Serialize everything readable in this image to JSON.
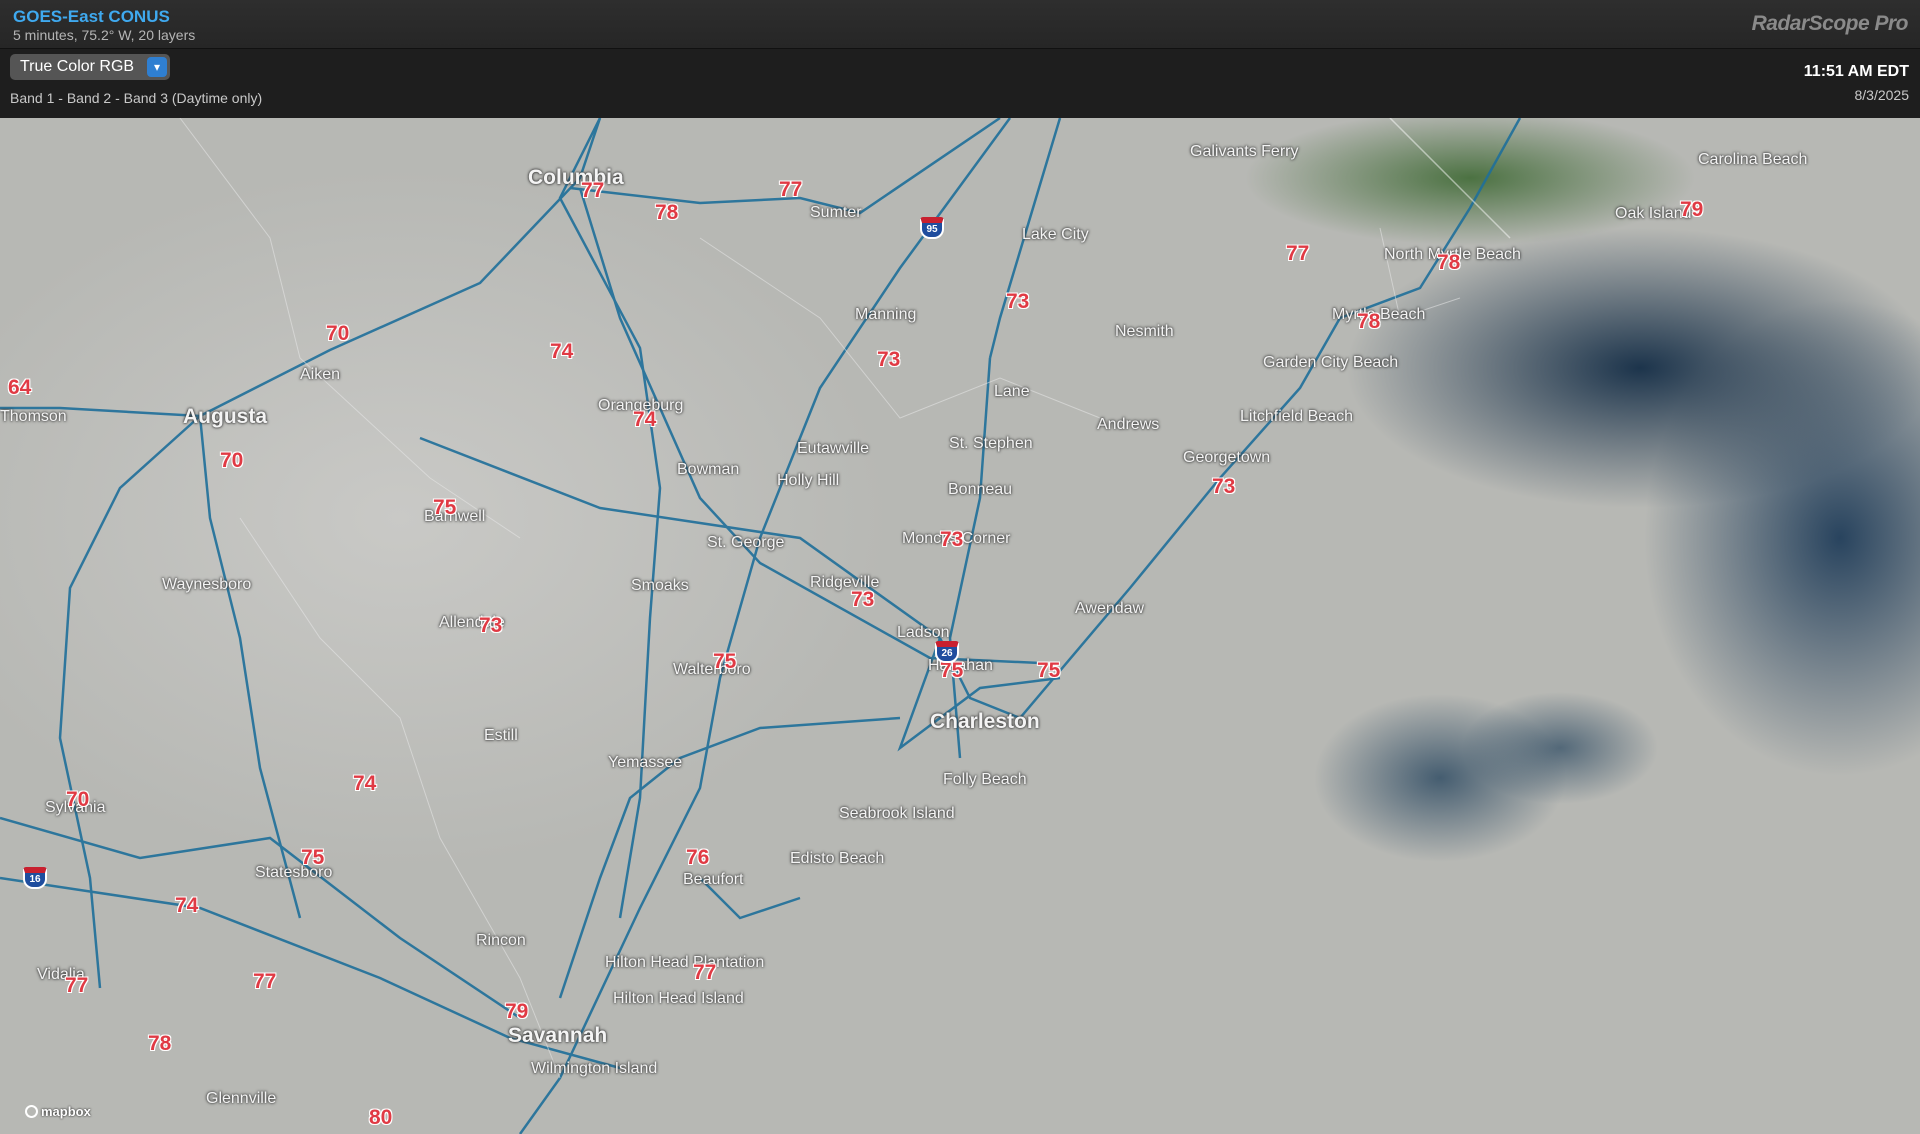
{
  "header": {
    "title": "GOES-East CONUS",
    "subtitle": "5 minutes, 75.2° W, 20 layers",
    "brand": "RadarScope Pro"
  },
  "controls": {
    "product": "True Color RGB",
    "band_description": "Band 1 - Band 2 - Band 3 (Daytime only)",
    "time": "11:51 AM EDT",
    "date": "8/3/2025"
  },
  "map": {
    "attribution": "mapbox",
    "places": [
      "Columbia",
      "Sumter",
      "Lake City",
      "Galivants Ferry",
      "Carolina Beach",
      "Oak Island",
      "North Myrtle Beach",
      "Myrtle Beach",
      "Manning",
      "Nesmith",
      "Garden City Beach",
      "Aiken",
      "Augusta",
      "Thomson",
      "Orangeburg",
      "Lane",
      "Andrews",
      "Litchfield Beach",
      "Eutawville",
      "St. Stephen",
      "Georgetown",
      "Bowman",
      "Holly Hill",
      "Bonneau",
      "Barnwell",
      "St. George",
      "Moncks Corner",
      "Waynesboro",
      "Smoaks",
      "Ridgeville",
      "Awendaw",
      "Allendale",
      "Ladson",
      "Hanahan",
      "Walterboro",
      "Charleston",
      "Estill",
      "Yemassee",
      "Folly Beach",
      "Sylvania",
      "Seabrook Island",
      "Statesboro",
      "Beaufort",
      "Edisto Beach",
      "Rincon",
      "Vidalia",
      "Hilton Head Plantation",
      "Hilton Head Island",
      "Savannah",
      "Wilmington Island",
      "Glennville"
    ],
    "temperatures": [
      "77",
      "78",
      "77",
      "77",
      "79",
      "78",
      "78",
      "73",
      "73",
      "70",
      "74",
      "64",
      "74",
      "70",
      "75",
      "73",
      "73",
      "73",
      "73",
      "75",
      "75",
      "75",
      "70",
      "74",
      "75",
      "76",
      "74",
      "77",
      "77",
      "79",
      "77",
      "78",
      "80"
    ],
    "interstates": [
      "95",
      "26",
      "16"
    ]
  }
}
